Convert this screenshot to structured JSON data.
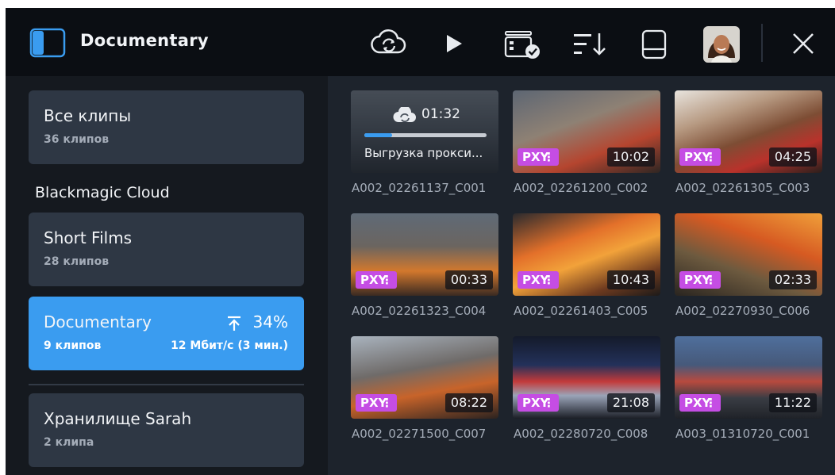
{
  "header": {
    "title": "Documentary",
    "icons": [
      "sidebar-toggle-icon",
      "cloud-sync-icon",
      "play-icon",
      "media-card-check-icon",
      "sort-icon",
      "drive-icon",
      "user-avatar",
      "close-icon"
    ]
  },
  "sidebar": {
    "all_clips": {
      "label": "Все клипы",
      "count": "36 клипов"
    },
    "section_title": "Blackmagic Cloud",
    "projects": [
      {
        "label": "Short Films",
        "count": "28 клипов"
      },
      {
        "label": "Documentary",
        "count": "9 клипов",
        "progress": "34%",
        "rate": "12 Мбит/с (3 мин.)"
      }
    ],
    "storage": {
      "label": "Хранилище Sarah",
      "count": "2 клипа"
    }
  },
  "uploading": {
    "time": "01:32",
    "status": "Выгрузка прокси...",
    "progress_fraction": 0.23
  },
  "badge_label": "PXY",
  "clips": [
    {
      "name": "A002_02261137_C001",
      "duration": ""
    },
    {
      "name": "A002_02261200_C002",
      "duration": "10:02"
    },
    {
      "name": "A002_02261305_C003",
      "duration": "04:25"
    },
    {
      "name": "A002_02261323_C004",
      "duration": "00:33"
    },
    {
      "name": "A002_02261403_C005",
      "duration": "10:43"
    },
    {
      "name": "A002_02270930_C006",
      "duration": "02:33"
    },
    {
      "name": "A002_02271500_C007",
      "duration": "08:22"
    },
    {
      "name": "A002_02280720_C008",
      "duration": "21:08"
    },
    {
      "name": "A003_01310720_C001",
      "duration": "11:22"
    }
  ],
  "colors": {
    "accent": "#3a9cf0",
    "badge": "#c54de4",
    "topbar": "#0b0e13",
    "card": "#2e3744"
  }
}
